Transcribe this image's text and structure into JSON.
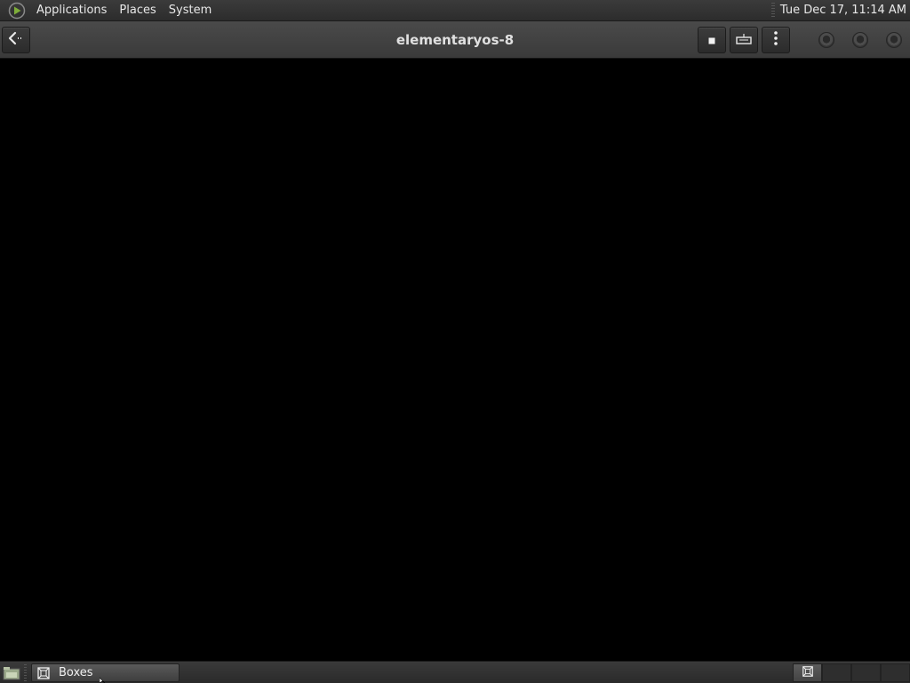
{
  "top_panel": {
    "menus": [
      "Applications",
      "Places",
      "System"
    ],
    "clock": "Tue Dec 17, 11:14 AM"
  },
  "window": {
    "title": "elementaryos-8",
    "buttons": {
      "back": "back-icon",
      "stop": "stop-icon",
      "keyboard": "keyboard-icon",
      "menu": "vertical-dots-icon"
    }
  },
  "taskbar": {
    "task_label": "Boxes",
    "task_icon": "boxes-icon"
  },
  "colors": {
    "panel_bg": "#2c2c2c",
    "header_bg": "#414141",
    "display_bg": "#000000",
    "logo_green": "#7fae3a"
  }
}
